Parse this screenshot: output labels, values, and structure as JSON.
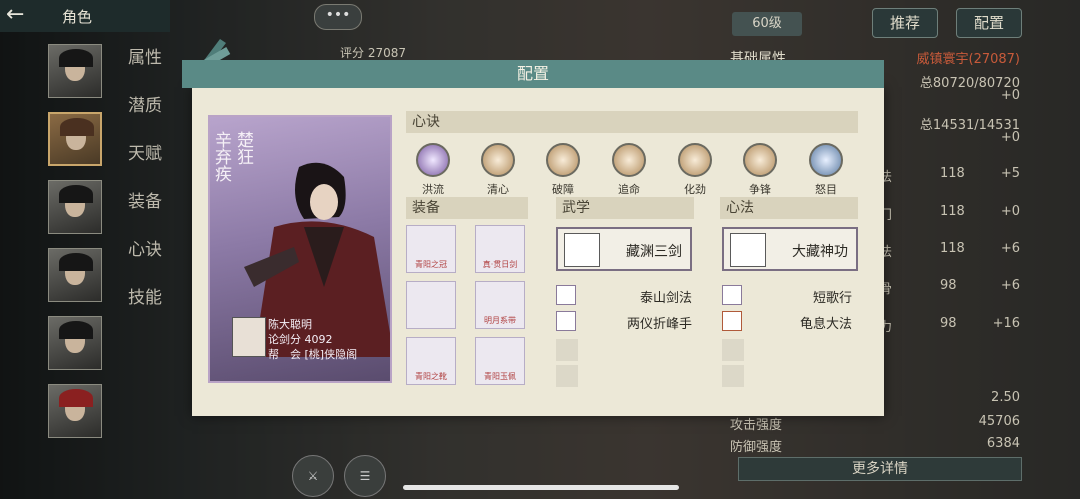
{
  "topbar": {
    "title": "角色",
    "back_icon": "back-arrow-icon"
  },
  "sidebar_nav": [
    "属性",
    "潜质",
    "天赋",
    "装备",
    "心诀",
    "技能"
  ],
  "top_buttons": {
    "recommend": "推荐",
    "config": "配置",
    "level": "60级"
  },
  "score_top": "评分 27087",
  "right_panel": {
    "section": "基础属性",
    "badge": "威镇寰宇(27087)",
    "hp": "总80720/80720",
    "hp_bonus": "+0",
    "mp": "总14531/14531",
    "mp_bonus": "+0",
    "stats": [
      {
        "label": "剑法",
        "value": "118",
        "bonus": "+5"
      },
      {
        "label": "奇门",
        "value": "118",
        "bonus": "+0"
      },
      {
        "label": "身法",
        "value": "118",
        "bonus": "+6"
      },
      {
        "label": "根骨",
        "value": "98",
        "bonus": "+6"
      },
      {
        "label": "定力",
        "value": "98",
        "bonus": "+16"
      }
    ],
    "extra": [
      {
        "label": "",
        "value": "2.50"
      },
      {
        "label": "攻击强度",
        "value": "45706"
      },
      {
        "label": "防御强度",
        "value": "6384"
      }
    ],
    "more_button": "更多详情"
  },
  "modal": {
    "title": "配置",
    "hero": {
      "name_right": "楚狂",
      "name_left": "辛弃疾",
      "player_name": "陈大聪明",
      "score": "论剑分 4092",
      "guild": "帮　会 [桃]侠隐阁"
    },
    "xinjue_label": "心诀",
    "xinjue_skills": [
      "洪流",
      "清心",
      "破障",
      "追命",
      "化劲",
      "争锋",
      "怒目"
    ],
    "equip_label": "装备",
    "equipment": [
      "青阳之冠",
      "真·贯日剑",
      "",
      "明月系带",
      "青阳之靴",
      "青阳玉佩"
    ],
    "wuxue_label": "武学",
    "wuxue_main": "藏渊三剑",
    "wuxue_list": [
      "泰山剑法",
      "两仪折峰手"
    ],
    "xinfa_label": "心法",
    "xinfa_main": "大藏神功",
    "xinfa_list": [
      "短歌行",
      "龟息大法"
    ]
  },
  "colors": {
    "header": "#5a8a86",
    "panel": "#ece8d7",
    "accent": "#c9a66b",
    "badge": "#c75a3a"
  }
}
